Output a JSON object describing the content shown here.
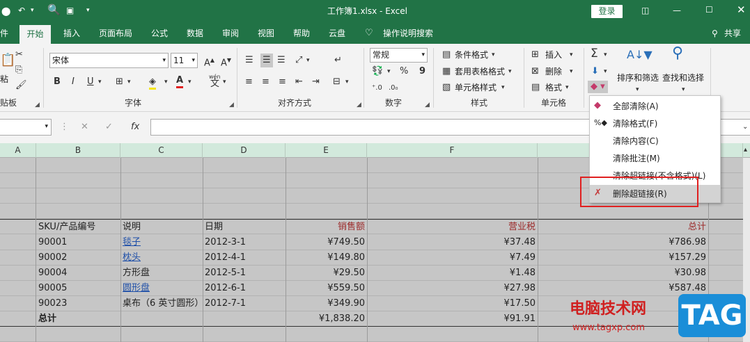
{
  "titlebar": {
    "doc_title": "工作簿1.xlsx  -  Excel",
    "login_label": "登录",
    "save_icon": "save-icon",
    "undo_icon": "undo-icon"
  },
  "tabs": [
    {
      "label": "件"
    },
    {
      "label": "开始"
    },
    {
      "label": "插入"
    },
    {
      "label": "页面布局"
    },
    {
      "label": "公式"
    },
    {
      "label": "数据"
    },
    {
      "label": "审阅"
    },
    {
      "label": "视图"
    },
    {
      "label": "帮助"
    },
    {
      "label": "云盘"
    },
    {
      "label": "操作说明搜索"
    }
  ],
  "share_label": "共享",
  "ribbon": {
    "clipboard": {
      "paste": "粘",
      "label": "贴板"
    },
    "font": {
      "name": "宋体",
      "size": "11",
      "label": "字体",
      "bold": "B",
      "italic": "I",
      "underline": "U",
      "wen": "wén",
      "wen_char": "文"
    },
    "align": {
      "label": "对齐方式"
    },
    "number": {
      "format": "常规",
      "label": "数字",
      "percent": "%",
      "comma": "9"
    },
    "styles": {
      "cond": "条件格式",
      "table": "套用表格格式",
      "cell": "单元格样式",
      "label": "样式"
    },
    "cells": {
      "insert": "插入",
      "delete": "删除",
      "format": "格式",
      "label": "单元格"
    },
    "editing": {
      "sort": "排序和筛选",
      "find": "查找和选择"
    }
  },
  "formula": {
    "fx": "fx"
  },
  "columns": [
    "A",
    "B",
    "C",
    "D",
    "E",
    "F"
  ],
  "table": {
    "headers": [
      "SKU/产品编号",
      "说明",
      "日期",
      "销售额",
      "营业税",
      "总计"
    ],
    "rows": [
      [
        "90001",
        "毯子",
        "2012-3-1",
        "¥749.50",
        "¥37.48",
        "¥786.98"
      ],
      [
        "90002",
        "枕头",
        "2012-4-1",
        "¥149.80",
        "¥7.49",
        "¥157.29"
      ],
      [
        "90004",
        "方形盘",
        "2012-5-1",
        "¥29.50",
        "¥1.48",
        "¥30.98"
      ],
      [
        "90005",
        "圆形盘",
        "2012-6-1",
        "¥559.50",
        "¥27.98",
        "¥587.48"
      ],
      [
        "90023",
        "桌布（6 英寸圆形）",
        "2012-7-1",
        "¥349.90",
        "¥17.50",
        ""
      ]
    ],
    "total_row": [
      "总计",
      "",
      "",
      "¥1,838.20",
      "¥91.91",
      ""
    ]
  },
  "menu": {
    "items": [
      {
        "label": "全部清除(A)",
        "icon": "eraser-icon"
      },
      {
        "label": "清除格式(F)",
        "icon": "clear-format-icon"
      },
      {
        "label": "清除内容(C)",
        "icon": ""
      },
      {
        "label": "清除批注(M)",
        "icon": ""
      },
      {
        "label": "清除超链接(不含格式)(L)",
        "icon": ""
      },
      {
        "label": "删除超链接(R)",
        "icon": "remove-hyperlink-icon"
      }
    ]
  },
  "watermark": {
    "text": "电脑技术网",
    "url": "www.tagxp.com",
    "badge": "TAG"
  },
  "colors": {
    "excel_green": "#217346",
    "highlight": "#e02020",
    "link": "#1e4fa8"
  }
}
